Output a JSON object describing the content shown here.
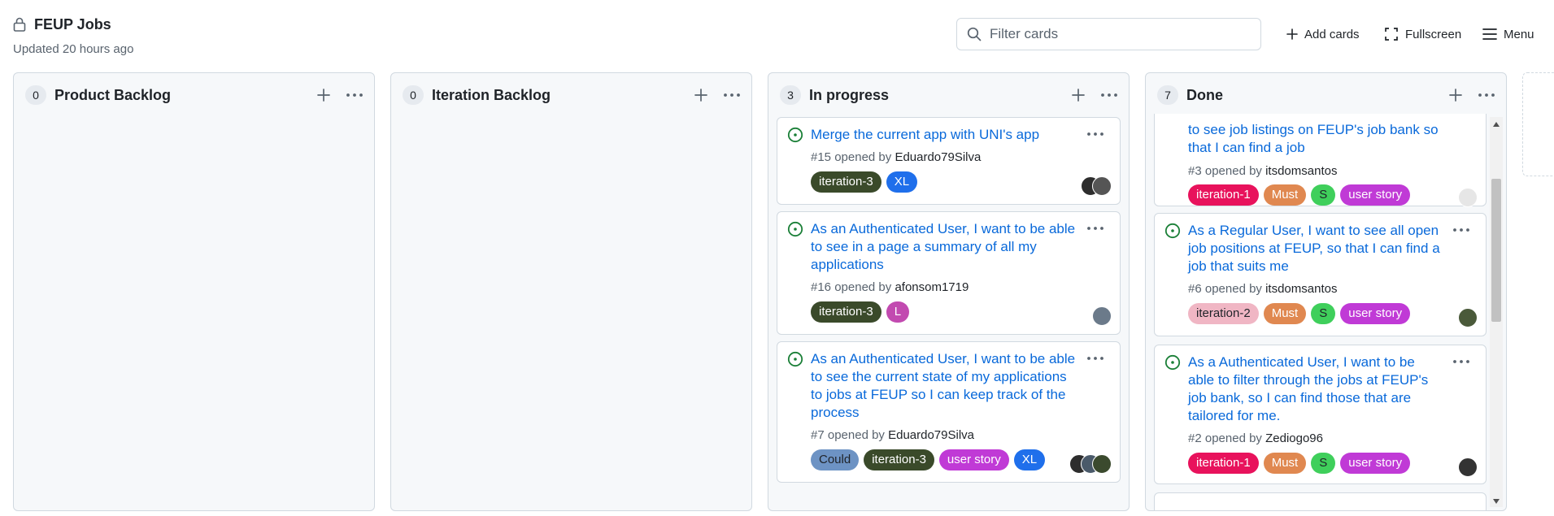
{
  "header": {
    "title": "FEUP Jobs",
    "updated": "Updated 20 hours ago",
    "search_placeholder": "Filter cards",
    "add_cards": "Add cards",
    "fullscreen": "Fullscreen",
    "menu": "Menu"
  },
  "columns": [
    {
      "name": "Product Backlog",
      "count": "0",
      "cards": []
    },
    {
      "name": "Iteration Backlog",
      "count": "0",
      "cards": []
    },
    {
      "name": "In progress",
      "count": "3",
      "cards": [
        {
          "title": "Merge the current app with UNI's app",
          "meta_prefix": "#15 opened by ",
          "user": "Eduardo79Silva",
          "labels": [
            {
              "text": "iteration-3",
              "color": "#3a4a2a"
            },
            {
              "text": "XL",
              "color": "#1f6feb"
            }
          ]
        },
        {
          "title": "As an Authenticated User, I want to be able to see in a page a summary of all my applications",
          "meta_prefix": "#16 opened by ",
          "user": "afonsom1719",
          "labels": [
            {
              "text": "iteration-3",
              "color": "#3a4a2a"
            },
            {
              "text": "L",
              "color": "#c24ab0"
            }
          ]
        },
        {
          "title": "As an Authenticated User, I want to be able to see the current state of my applications to jobs at FEUP so I can keep track of the process",
          "meta_prefix": "#7 opened by ",
          "user": "Eduardo79Silva",
          "labels": [
            {
              "text": "Could",
              "color": "#6d93c4",
              "text_color": "#1f2328"
            },
            {
              "text": "iteration-3",
              "color": "#3a4a2a"
            },
            {
              "text": "user story",
              "color": "#c03ad6"
            },
            {
              "text": "XL",
              "color": "#1f6feb"
            }
          ]
        }
      ]
    },
    {
      "name": "Done",
      "count": "7",
      "cards": [
        {
          "title": "to see job listings on FEUP's job bank so that I can find a job",
          "meta_prefix": "#3 opened by ",
          "user": "itsdomsantos",
          "labels": [
            {
              "text": "iteration-1",
              "color": "#e8125c"
            },
            {
              "text": "Must",
              "color": "#e08850"
            },
            {
              "text": "S",
              "color": "#3fcf5b",
              "text_color": "#1f2328"
            },
            {
              "text": "user story",
              "color": "#c03ad6"
            }
          ]
        },
        {
          "title": "As a Regular User, I want to see all open job positions at FEUP, so that I can find a job that suits me",
          "meta_prefix": "#6 opened by ",
          "user": "itsdomsantos",
          "labels": [
            {
              "text": "iteration-2",
              "color": "#f0b6c4",
              "text_color": "#1f2328"
            },
            {
              "text": "Must",
              "color": "#e08850"
            },
            {
              "text": "S",
              "color": "#3fcf5b",
              "text_color": "#1f2328"
            },
            {
              "text": "user story",
              "color": "#c03ad6"
            }
          ]
        },
        {
          "title": "As a Authenticated User, I want to be able to filter through the jobs at FEUP's job bank, so I can find those that are tailored for me.",
          "meta_prefix": "#2 opened by ",
          "user": "Zediogo96",
          "labels": [
            {
              "text": "iteration-1",
              "color": "#e8125c"
            },
            {
              "text": "Must",
              "color": "#e08850"
            },
            {
              "text": "S",
              "color": "#3fcf5b",
              "text_color": "#1f2328"
            },
            {
              "text": "user story",
              "color": "#c03ad6"
            }
          ]
        }
      ]
    }
  ],
  "icons": {
    "lock": "lock-icon",
    "search": "search-icon",
    "plus": "plus-icon",
    "fullscreen": "fullscreen-icon",
    "menu": "hamburger-icon",
    "more": "kebab-icon",
    "issue_open": "issue-opened-icon"
  },
  "colors": {
    "link": "#0969da",
    "issue_open": "#1a7f37",
    "muted": "#59636e"
  }
}
